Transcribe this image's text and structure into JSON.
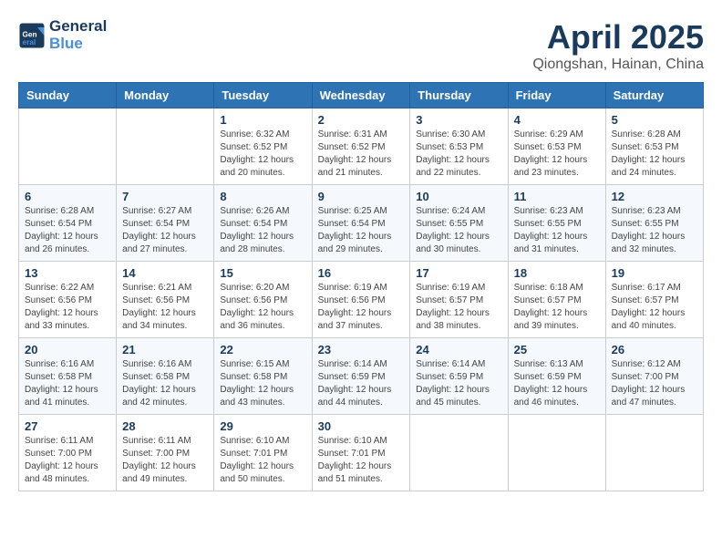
{
  "header": {
    "logo_line1": "General",
    "logo_line2": "Blue",
    "month": "April 2025",
    "location": "Qiongshan, Hainan, China"
  },
  "weekdays": [
    "Sunday",
    "Monday",
    "Tuesday",
    "Wednesday",
    "Thursday",
    "Friday",
    "Saturday"
  ],
  "weeks": [
    [
      {
        "day": "",
        "sunrise": "",
        "sunset": "",
        "daylight": ""
      },
      {
        "day": "",
        "sunrise": "",
        "sunset": "",
        "daylight": ""
      },
      {
        "day": "1",
        "sunrise": "Sunrise: 6:32 AM",
        "sunset": "Sunset: 6:52 PM",
        "daylight": "Daylight: 12 hours and 20 minutes."
      },
      {
        "day": "2",
        "sunrise": "Sunrise: 6:31 AM",
        "sunset": "Sunset: 6:52 PM",
        "daylight": "Daylight: 12 hours and 21 minutes."
      },
      {
        "day": "3",
        "sunrise": "Sunrise: 6:30 AM",
        "sunset": "Sunset: 6:53 PM",
        "daylight": "Daylight: 12 hours and 22 minutes."
      },
      {
        "day": "4",
        "sunrise": "Sunrise: 6:29 AM",
        "sunset": "Sunset: 6:53 PM",
        "daylight": "Daylight: 12 hours and 23 minutes."
      },
      {
        "day": "5",
        "sunrise": "Sunrise: 6:28 AM",
        "sunset": "Sunset: 6:53 PM",
        "daylight": "Daylight: 12 hours and 24 minutes."
      }
    ],
    [
      {
        "day": "6",
        "sunrise": "Sunrise: 6:28 AM",
        "sunset": "Sunset: 6:54 PM",
        "daylight": "Daylight: 12 hours and 26 minutes."
      },
      {
        "day": "7",
        "sunrise": "Sunrise: 6:27 AM",
        "sunset": "Sunset: 6:54 PM",
        "daylight": "Daylight: 12 hours and 27 minutes."
      },
      {
        "day": "8",
        "sunrise": "Sunrise: 6:26 AM",
        "sunset": "Sunset: 6:54 PM",
        "daylight": "Daylight: 12 hours and 28 minutes."
      },
      {
        "day": "9",
        "sunrise": "Sunrise: 6:25 AM",
        "sunset": "Sunset: 6:54 PM",
        "daylight": "Daylight: 12 hours and 29 minutes."
      },
      {
        "day": "10",
        "sunrise": "Sunrise: 6:24 AM",
        "sunset": "Sunset: 6:55 PM",
        "daylight": "Daylight: 12 hours and 30 minutes."
      },
      {
        "day": "11",
        "sunrise": "Sunrise: 6:23 AM",
        "sunset": "Sunset: 6:55 PM",
        "daylight": "Daylight: 12 hours and 31 minutes."
      },
      {
        "day": "12",
        "sunrise": "Sunrise: 6:23 AM",
        "sunset": "Sunset: 6:55 PM",
        "daylight": "Daylight: 12 hours and 32 minutes."
      }
    ],
    [
      {
        "day": "13",
        "sunrise": "Sunrise: 6:22 AM",
        "sunset": "Sunset: 6:56 PM",
        "daylight": "Daylight: 12 hours and 33 minutes."
      },
      {
        "day": "14",
        "sunrise": "Sunrise: 6:21 AM",
        "sunset": "Sunset: 6:56 PM",
        "daylight": "Daylight: 12 hours and 34 minutes."
      },
      {
        "day": "15",
        "sunrise": "Sunrise: 6:20 AM",
        "sunset": "Sunset: 6:56 PM",
        "daylight": "Daylight: 12 hours and 36 minutes."
      },
      {
        "day": "16",
        "sunrise": "Sunrise: 6:19 AM",
        "sunset": "Sunset: 6:56 PM",
        "daylight": "Daylight: 12 hours and 37 minutes."
      },
      {
        "day": "17",
        "sunrise": "Sunrise: 6:19 AM",
        "sunset": "Sunset: 6:57 PM",
        "daylight": "Daylight: 12 hours and 38 minutes."
      },
      {
        "day": "18",
        "sunrise": "Sunrise: 6:18 AM",
        "sunset": "Sunset: 6:57 PM",
        "daylight": "Daylight: 12 hours and 39 minutes."
      },
      {
        "day": "19",
        "sunrise": "Sunrise: 6:17 AM",
        "sunset": "Sunset: 6:57 PM",
        "daylight": "Daylight: 12 hours and 40 minutes."
      }
    ],
    [
      {
        "day": "20",
        "sunrise": "Sunrise: 6:16 AM",
        "sunset": "Sunset: 6:58 PM",
        "daylight": "Daylight: 12 hours and 41 minutes."
      },
      {
        "day": "21",
        "sunrise": "Sunrise: 6:16 AM",
        "sunset": "Sunset: 6:58 PM",
        "daylight": "Daylight: 12 hours and 42 minutes."
      },
      {
        "day": "22",
        "sunrise": "Sunrise: 6:15 AM",
        "sunset": "Sunset: 6:58 PM",
        "daylight": "Daylight: 12 hours and 43 minutes."
      },
      {
        "day": "23",
        "sunrise": "Sunrise: 6:14 AM",
        "sunset": "Sunset: 6:59 PM",
        "daylight": "Daylight: 12 hours and 44 minutes."
      },
      {
        "day": "24",
        "sunrise": "Sunrise: 6:14 AM",
        "sunset": "Sunset: 6:59 PM",
        "daylight": "Daylight: 12 hours and 45 minutes."
      },
      {
        "day": "25",
        "sunrise": "Sunrise: 6:13 AM",
        "sunset": "Sunset: 6:59 PM",
        "daylight": "Daylight: 12 hours and 46 minutes."
      },
      {
        "day": "26",
        "sunrise": "Sunrise: 6:12 AM",
        "sunset": "Sunset: 7:00 PM",
        "daylight": "Daylight: 12 hours and 47 minutes."
      }
    ],
    [
      {
        "day": "27",
        "sunrise": "Sunrise: 6:11 AM",
        "sunset": "Sunset: 7:00 PM",
        "daylight": "Daylight: 12 hours and 48 minutes."
      },
      {
        "day": "28",
        "sunrise": "Sunrise: 6:11 AM",
        "sunset": "Sunset: 7:00 PM",
        "daylight": "Daylight: 12 hours and 49 minutes."
      },
      {
        "day": "29",
        "sunrise": "Sunrise: 6:10 AM",
        "sunset": "Sunset: 7:01 PM",
        "daylight": "Daylight: 12 hours and 50 minutes."
      },
      {
        "day": "30",
        "sunrise": "Sunrise: 6:10 AM",
        "sunset": "Sunset: 7:01 PM",
        "daylight": "Daylight: 12 hours and 51 minutes."
      },
      {
        "day": "",
        "sunrise": "",
        "sunset": "",
        "daylight": ""
      },
      {
        "day": "",
        "sunrise": "",
        "sunset": "",
        "daylight": ""
      },
      {
        "day": "",
        "sunrise": "",
        "sunset": "",
        "daylight": ""
      }
    ]
  ]
}
